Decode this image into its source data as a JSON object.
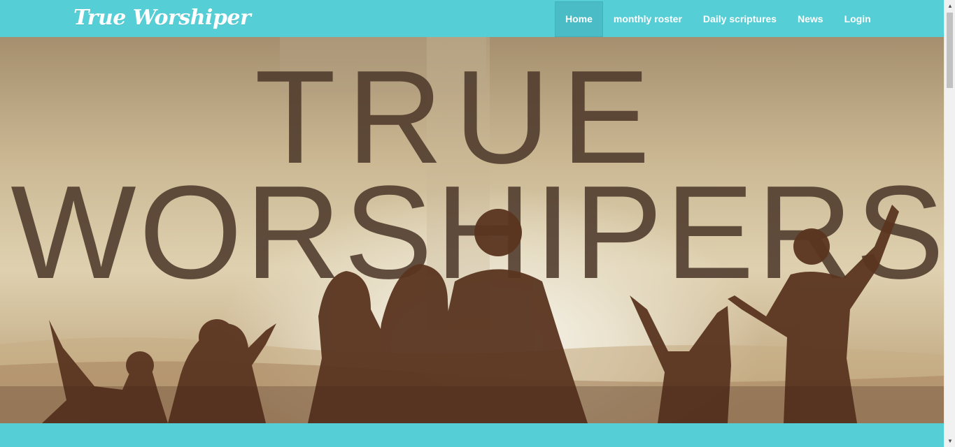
{
  "navbar": {
    "brand": "True Worshiper",
    "items": [
      {
        "label": "Home",
        "active": true
      },
      {
        "label": "monthly roster",
        "active": false
      },
      {
        "label": "Daily scriptures",
        "active": false
      },
      {
        "label": "News",
        "active": false
      },
      {
        "label": "Login",
        "active": false
      }
    ]
  },
  "hero": {
    "line1": "TRUE",
    "line2": "WORSHIPERS"
  },
  "colors": {
    "navbar": "#55ced6",
    "nav_active": "#49bcc6",
    "silhouette": "#5a3520",
    "hero_text": "#4f3a2c"
  },
  "scrollbar": {
    "up_icon": "triangle-up-icon",
    "down_icon": "triangle-down-icon"
  }
}
